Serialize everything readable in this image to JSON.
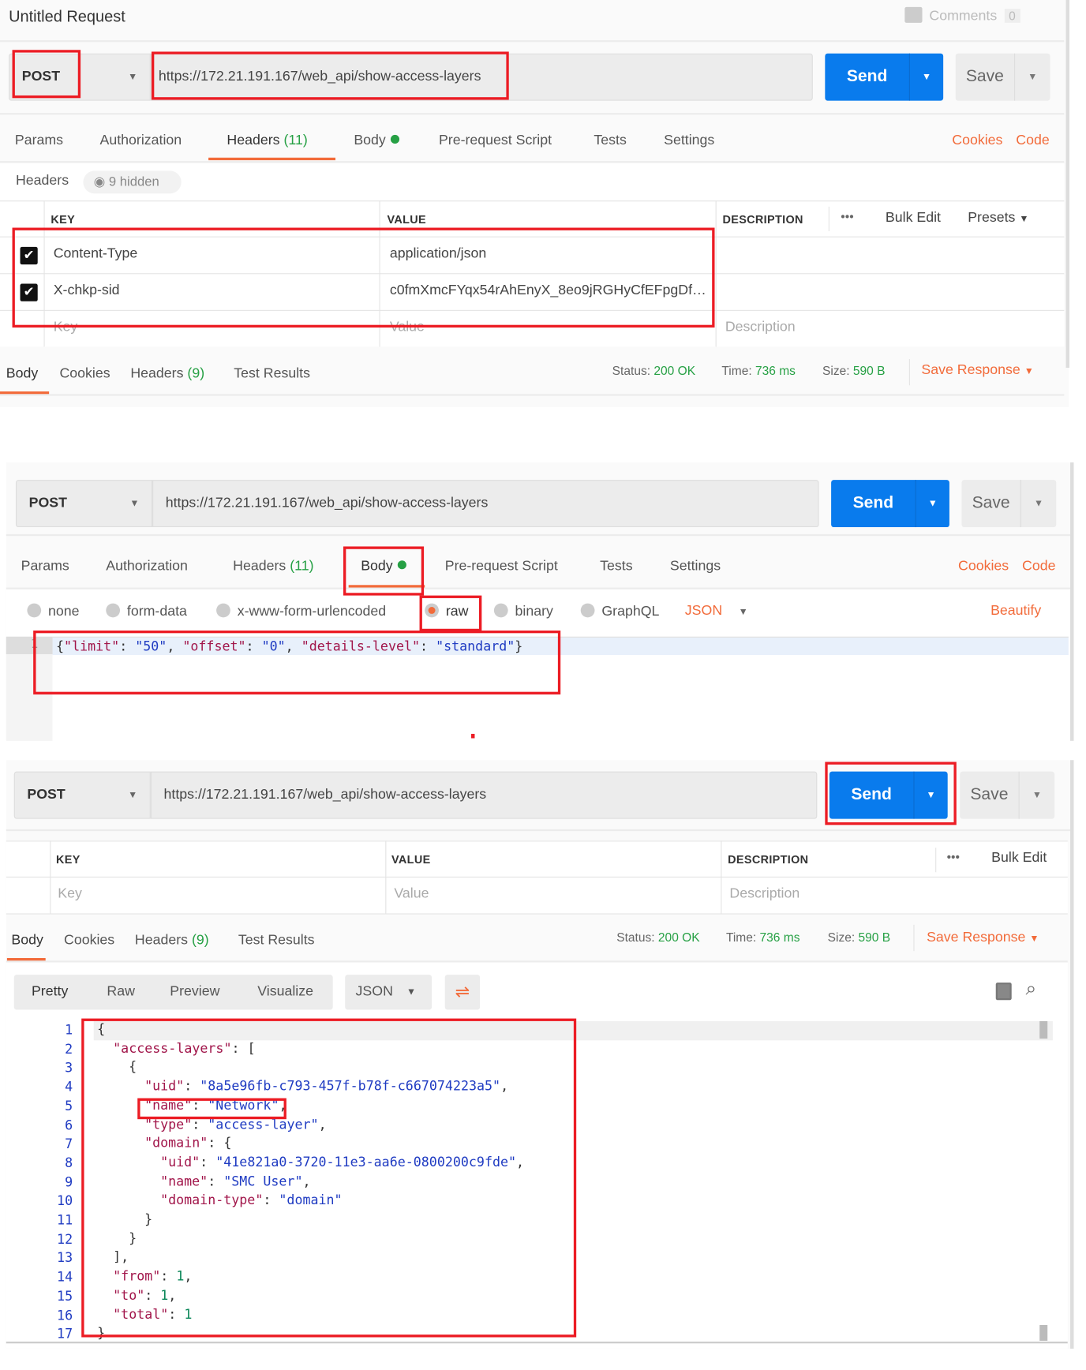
{
  "colors": {
    "accent": "#f26b3a",
    "send": "#097bed",
    "success": "#26a044",
    "annotation": "#ec1c24"
  },
  "panel1": {
    "title": "Untitled Request",
    "comments_label": "Comments",
    "comments_count": "0",
    "method": "POST",
    "url": "https://172.21.191.167/web_api/show-access-layers",
    "send": "Send",
    "save": "Save",
    "tabs": {
      "params": "Params",
      "authorization": "Authorization",
      "headers": "Headers",
      "headers_count": "(11)",
      "body": "Body",
      "prerequest": "Pre-request Script",
      "tests": "Tests",
      "settings": "Settings"
    },
    "active_tab": "Headers",
    "cookies": "Cookies",
    "code": "Code",
    "headers_label": "Headers",
    "hidden": "9 hidden",
    "table": {
      "key": "KEY",
      "value": "VALUE",
      "description": "DESCRIPTION",
      "more": "•••",
      "bulk_edit": "Bulk Edit",
      "presets": "Presets",
      "rows": [
        {
          "checked": true,
          "key": "Content-Type",
          "value": "application/json"
        },
        {
          "checked": true,
          "key": "X-chkp-sid",
          "value": "c0fmXmcFYqx54rAhEnyX_8eo9jRGHyCfEFpgDf…"
        }
      ],
      "placeholder": {
        "key": "Key",
        "value": "Value",
        "description": "Description"
      }
    },
    "response": {
      "tabs": {
        "body": "Body",
        "cookies": "Cookies",
        "headers": "Headers",
        "headers_count": "(9)",
        "tests": "Test Results"
      },
      "status_label": "Status:",
      "status": "200 OK",
      "time_label": "Time:",
      "time": "736 ms",
      "size_label": "Size:",
      "size": "590 B",
      "save_response": "Save Response"
    }
  },
  "panel2": {
    "method": "POST",
    "url": "https://172.21.191.167/web_api/show-access-layers",
    "send": "Send",
    "save": "Save",
    "tabs": {
      "params": "Params",
      "authorization": "Authorization",
      "headers": "Headers",
      "headers_count": "(11)",
      "body": "Body",
      "prerequest": "Pre-request Script",
      "tests": "Tests",
      "settings": "Settings"
    },
    "active_tab": "Body",
    "cookies": "Cookies",
    "code": "Code",
    "body_types": [
      "none",
      "form-data",
      "x-www-form-urlencoded",
      "raw",
      "binary",
      "GraphQL"
    ],
    "selected_body_type": "raw",
    "format": "JSON",
    "beautify": "Beautify",
    "editor": {
      "line_number": "1",
      "tokens": [
        [
          "p",
          "{"
        ],
        [
          "k",
          "\"limit\""
        ],
        [
          "p",
          ": "
        ],
        [
          "s",
          "\"50\""
        ],
        [
          "p",
          ", "
        ],
        [
          "k",
          "\"offset\""
        ],
        [
          "p",
          ": "
        ],
        [
          "s",
          "\"0\""
        ],
        [
          "p",
          ", "
        ],
        [
          "k",
          "\"details-level\""
        ],
        [
          "p",
          ": "
        ],
        [
          "s",
          "\"standard\""
        ],
        [
          "p",
          "}"
        ]
      ]
    }
  },
  "panel3": {
    "method": "POST",
    "url": "https://172.21.191.167/web_api/show-access-layers",
    "send": "Send",
    "save": "Save",
    "table": {
      "key": "KEY",
      "value": "VALUE",
      "description": "DESCRIPTION",
      "more": "•••",
      "bulk_edit": "Bulk Edit",
      "placeholder": {
        "key": "Key",
        "value": "Value",
        "description": "Description"
      }
    },
    "response": {
      "tabs": {
        "body": "Body",
        "cookies": "Cookies",
        "headers": "Headers",
        "headers_count": "(9)",
        "tests": "Test Results"
      },
      "status_label": "Status:",
      "status": "200 OK",
      "time_label": "Time:",
      "time": "736 ms",
      "size_label": "Size:",
      "size": "590 B",
      "save_response": "Save Response"
    },
    "view_modes": [
      "Pretty",
      "Raw",
      "Preview",
      "Visualize"
    ],
    "active_view": "Pretty",
    "format": "JSON",
    "icons": [
      "wrap-lines-icon",
      "copy-icon",
      "search-icon"
    ],
    "code_lines": [
      {
        "indent": 0,
        "tokens": [
          [
            "p",
            "{"
          ]
        ]
      },
      {
        "indent": 1,
        "tokens": [
          [
            "k",
            "\"access-layers\""
          ],
          [
            "p",
            ": ["
          ]
        ]
      },
      {
        "indent": 2,
        "tokens": [
          [
            "p",
            "{"
          ]
        ]
      },
      {
        "indent": 3,
        "tokens": [
          [
            "k",
            "\"uid\""
          ],
          [
            "p",
            ": "
          ],
          [
            "s",
            "\"8a5e96fb-c793-457f-b78f-c667074223a5\""
          ],
          [
            "p",
            ","
          ]
        ]
      },
      {
        "indent": 3,
        "tokens": [
          [
            "k",
            "\"name\""
          ],
          [
            "p",
            ": "
          ],
          [
            "s",
            "\"Network\""
          ],
          [
            "p",
            ","
          ]
        ]
      },
      {
        "indent": 3,
        "tokens": [
          [
            "k",
            "\"type\""
          ],
          [
            "p",
            ": "
          ],
          [
            "s",
            "\"access-layer\""
          ],
          [
            "p",
            ","
          ]
        ]
      },
      {
        "indent": 3,
        "tokens": [
          [
            "k",
            "\"domain\""
          ],
          [
            "p",
            ": {"
          ]
        ]
      },
      {
        "indent": 4,
        "tokens": [
          [
            "k",
            "\"uid\""
          ],
          [
            "p",
            ": "
          ],
          [
            "s",
            "\"41e821a0-3720-11e3-aa6e-0800200c9fde\""
          ],
          [
            "p",
            ","
          ]
        ]
      },
      {
        "indent": 4,
        "tokens": [
          [
            "k",
            "\"name\""
          ],
          [
            "p",
            ": "
          ],
          [
            "s",
            "\"SMC User\""
          ],
          [
            "p",
            ","
          ]
        ]
      },
      {
        "indent": 4,
        "tokens": [
          [
            "k",
            "\"domain-type\""
          ],
          [
            "p",
            ": "
          ],
          [
            "s",
            "\"domain\""
          ]
        ]
      },
      {
        "indent": 3,
        "tokens": [
          [
            "p",
            "}"
          ]
        ]
      },
      {
        "indent": 2,
        "tokens": [
          [
            "p",
            "}"
          ]
        ]
      },
      {
        "indent": 1,
        "tokens": [
          [
            "p",
            "],"
          ]
        ]
      },
      {
        "indent": 1,
        "tokens": [
          [
            "k",
            "\"from\""
          ],
          [
            "p",
            ": "
          ],
          [
            "n",
            "1"
          ],
          [
            "p",
            ","
          ]
        ]
      },
      {
        "indent": 1,
        "tokens": [
          [
            "k",
            "\"to\""
          ],
          [
            "p",
            ": "
          ],
          [
            "n",
            "1"
          ],
          [
            "p",
            ","
          ]
        ]
      },
      {
        "indent": 1,
        "tokens": [
          [
            "k",
            "\"total\""
          ],
          [
            "p",
            ": "
          ],
          [
            "n",
            "1"
          ]
        ]
      },
      {
        "indent": 0,
        "tokens": [
          [
            "p",
            "}"
          ]
        ]
      }
    ]
  }
}
